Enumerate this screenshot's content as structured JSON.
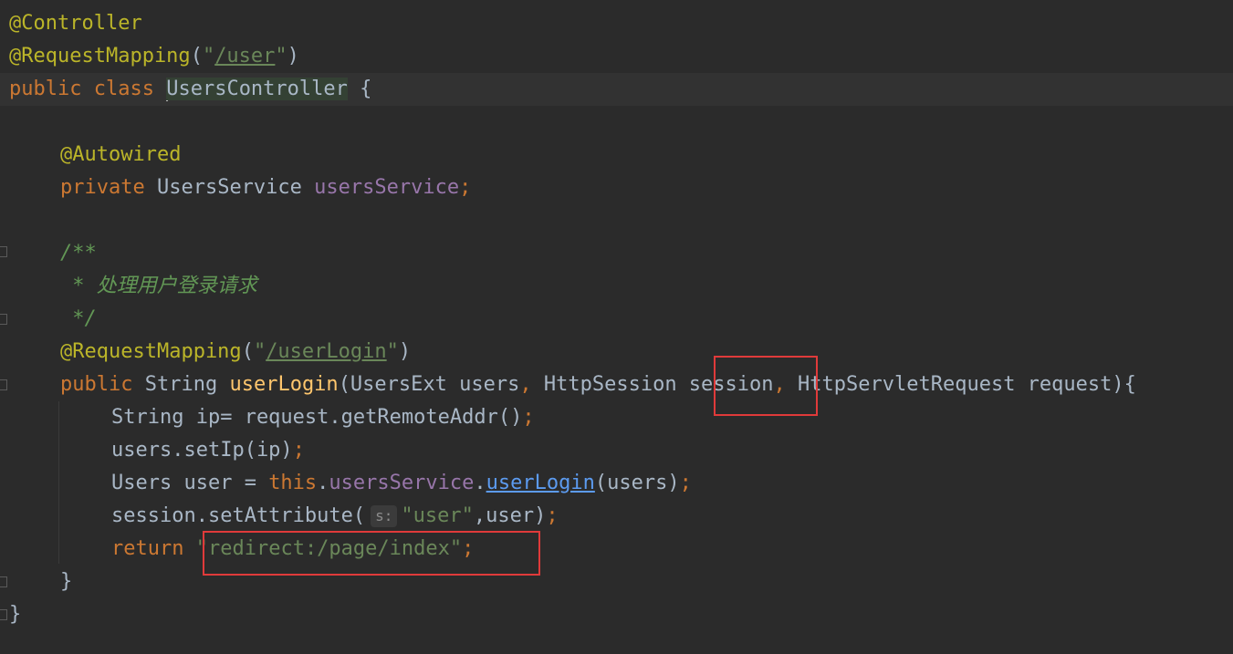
{
  "editor": {
    "lines": {
      "l1": {
        "annotation": "@Controller"
      },
      "l2": {
        "annotation": "@RequestMapping",
        "open": "(",
        "quote_open": "\"",
        "path": "/user",
        "quote_close": "\"",
        "close": ")"
      },
      "l3": {
        "kw_public": "public",
        "kw_class": "class",
        "class_name": "UsersController",
        "brace": "{"
      },
      "l5": {
        "annotation": "@Autowired"
      },
      "l6": {
        "kw_private": "private",
        "type": "UsersService",
        "field": "usersService",
        "semi": ";"
      },
      "l8": {
        "comment": "/**"
      },
      "l9": {
        "comment": " * 处理用户登录请求"
      },
      "l10": {
        "comment": " */"
      },
      "l11": {
        "annotation": "@RequestMapping",
        "open": "(",
        "quote_open": "\"",
        "path": "/userLogin",
        "quote_close": "\"",
        "close": ")"
      },
      "l12": {
        "kw_public": "public",
        "ret_type": "String",
        "method": "userLogin",
        "params_a": "(UsersExt users",
        "comma1": ",",
        "params_b": " HttpSession session",
        "comma2": ",",
        "params_c": " HttpServletRequest request){"
      },
      "l13": {
        "text": "String ip= request.getRemoteAddr()",
        "semi": ";"
      },
      "l14": {
        "text": "users.setIp(ip)",
        "semi": ";"
      },
      "l15": {
        "type": "Users user = ",
        "kw_this": "this",
        "dot1": ".",
        "field": "usersService",
        "dot2": ".",
        "method": "userLogin",
        "rest": "(users)",
        "semi": ";"
      },
      "l16": {
        "text": "session.setAttribute(",
        "hint": "s:",
        "str": "\"user\"",
        "rest": ",user)",
        "semi": ";"
      },
      "l17": {
        "kw_return": "return",
        "str": "\"redirect:/page/index\"",
        "semi": ";"
      },
      "l18": {
        "brace": "}"
      },
      "l19": {
        "brace": "}"
      }
    },
    "colors": {
      "background": "#2b2b2b",
      "keyword": "#cc7832",
      "annotation": "#bbb529",
      "string": "#6a8759",
      "field": "#9876aa",
      "function": "#ffc66d",
      "comment": "#629755",
      "highlight_box": "#e03a3a"
    }
  }
}
